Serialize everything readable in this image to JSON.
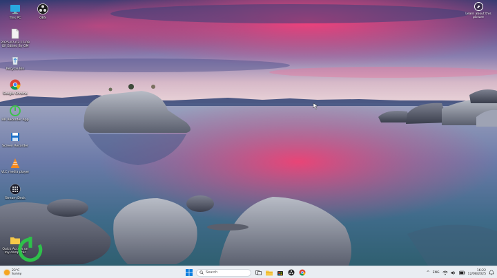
{
  "desktop": {
    "icons": [
      {
        "label": "This PC",
        "icon": "monitor-icon"
      },
      {
        "label": "OBS",
        "icon": "obs-icon"
      },
      {
        "label": "2025-07-03 11-09 Gif Edited By GM",
        "icon": "file-icon"
      },
      {
        "label": "Recycle Bin",
        "icon": "recycle-bin-icon"
      },
      {
        "label": "Google Chrome",
        "icon": "chrome-icon"
      },
      {
        "label": "HR Recorder App",
        "icon": "recorder-icon"
      },
      {
        "label": "Screen Recorder",
        "icon": "disk-icon"
      },
      {
        "label": "VLC media player",
        "icon": "vlc-icon"
      },
      {
        "label": "Stream Deck",
        "icon": "stream-deck-icon"
      },
      {
        "label": "Quick Access on my computer",
        "icon": "folder-icon"
      }
    ],
    "learn_about": {
      "label": "Learn about this picture",
      "icon": "learn-about-icon"
    }
  },
  "taskbar": {
    "weather": {
      "temp": "23°C",
      "condition": "Sunny"
    },
    "search_placeholder": "Search",
    "apps": [
      "start-icon",
      "search-icon",
      "task-view-icon",
      "file-explorer-icon",
      "store-icon",
      "obs-icon",
      "chrome-icon"
    ],
    "tray": {
      "chevron": "^",
      "language": "ENG"
    },
    "clock": {
      "time": "16:22",
      "date": "12/08/2025"
    }
  },
  "colors": {
    "taskbar_bg": "#e9edf2",
    "accent": "#0067c0"
  }
}
